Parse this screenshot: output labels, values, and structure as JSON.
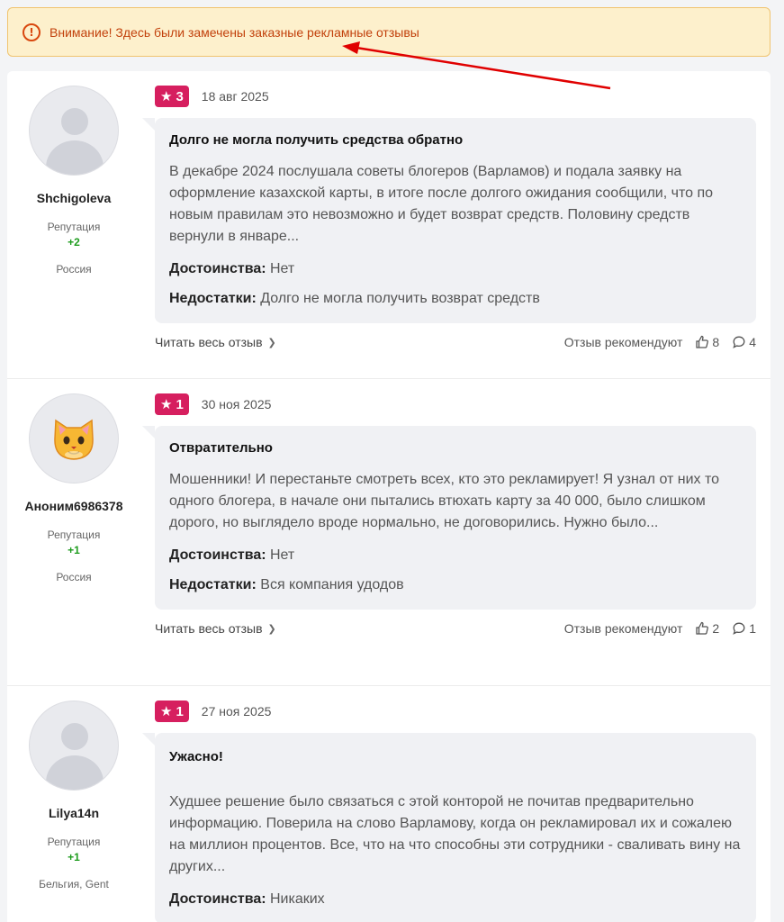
{
  "warning": {
    "icon": "exclamation-circle-icon",
    "text": "Внимание! Здесь были замечены заказные рекламные отзывы"
  },
  "labels": {
    "reputation": "Репутация",
    "pros": "Достоинства:",
    "cons": "Недостатки:",
    "read_more": "Читать весь отзыв",
    "recommend": "Отзыв рекомендуют"
  },
  "reviews": [
    {
      "author": "Shchigoleva",
      "avatar": "default-avatar",
      "reputation": "+2",
      "location": "Россия",
      "rating": "3",
      "date": "18 авг 2025",
      "title": "Долго не могла получить средства обратно",
      "text": "В декабре 2024 послушала советы блогеров (Варламов) и подала заявку на оформление казахской карты, в итоге после долгого ожидания сообщили, что по новым правилам это невозможно и будет возврат средств. Половину средств вернули в январе...",
      "pros": "Нет",
      "cons": "Долго не могла получить возврат средств",
      "likes": "8",
      "comments": "4"
    },
    {
      "author": "Аноним6986378",
      "avatar": "cat-emoji-avatar",
      "reputation": "+1",
      "location": "Россия",
      "rating": "1",
      "date": "30 ноя 2025",
      "title": "Отвратительно",
      "text": "Мошенники! И перестаньте смотреть всех, кто это рекламирует! Я узнал от них то одного блогера, в начале они пытались втюхать карту за 40 000, было слишком дорого, но выглядело вроде нормально, не договорились. Нужно было...",
      "pros": "Нет",
      "cons": "Вся компания удодов",
      "likes": "2",
      "comments": "1"
    },
    {
      "author": "Lilya14n",
      "avatar": "default-avatar",
      "reputation": "+1",
      "location": "Бельгия, Gent",
      "rating": "1",
      "date": "27 ноя 2025",
      "title": "Ужасно!",
      "text": "Худшее решение было связаться с этой конторой не почитав предварительно информацию. Поверила на слово Варламову, когда он рекламировал их и сожалею на миллион процентов. Все, что на что способны эти сотрудники - сваливать вину на других...",
      "pros": "Никаких"
    }
  ],
  "colors": {
    "rating_badge": "#d61f5f",
    "warning_bg": "#fdf0cc",
    "warning_text": "#c2410c",
    "reputation_positive": "#1e9c1e",
    "annotation_arrow": "#e00000"
  }
}
